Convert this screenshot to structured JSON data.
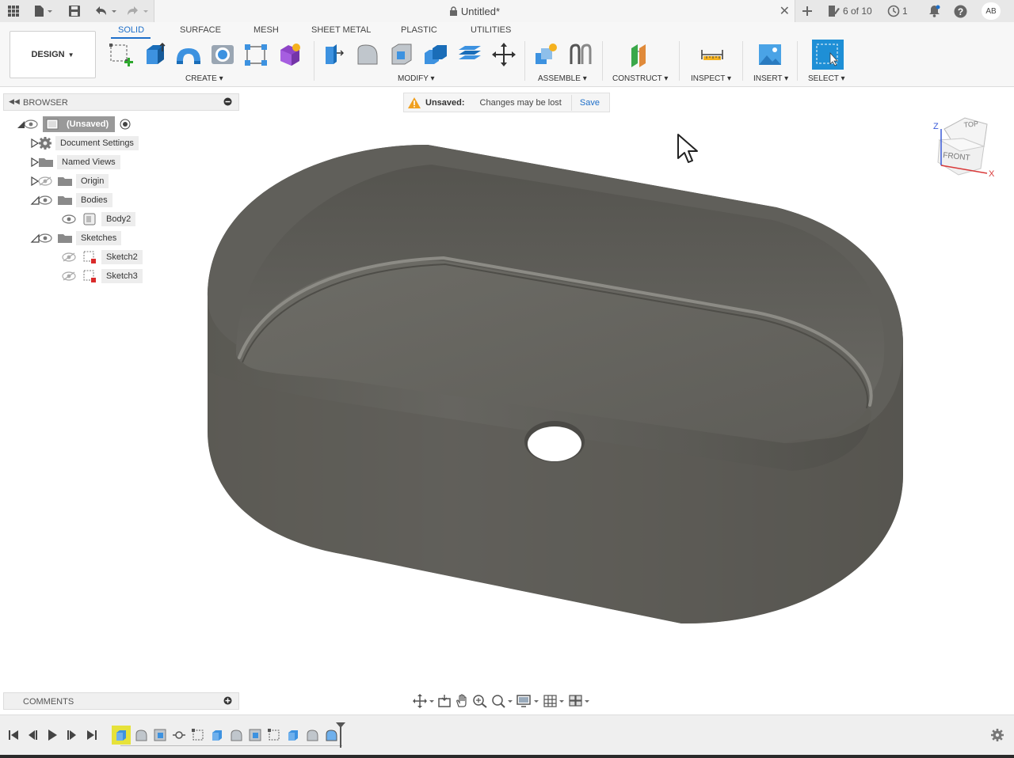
{
  "titlebar": {
    "doc_title": "Untitled*",
    "jobs_count": "6 of 10",
    "history_count": "1",
    "user_initials": "AB"
  },
  "toolbar": {
    "workspace_label": "DESIGN",
    "tabs": [
      "SOLID",
      "SURFACE",
      "MESH",
      "SHEET METAL",
      "PLASTIC",
      "UTILITIES"
    ],
    "groups": {
      "create": "CREATE",
      "modify": "MODIFY",
      "assemble": "ASSEMBLE",
      "construct": "CONSTRUCT",
      "inspect": "INSPECT",
      "insert": "INSERT",
      "select": "SELECT"
    }
  },
  "browser": {
    "title": "BROWSER",
    "root": "(Unsaved)",
    "items": {
      "document_settings": "Document Settings",
      "named_views": "Named Views",
      "origin": "Origin",
      "bodies": "Bodies",
      "body2": "Body2",
      "sketches": "Sketches",
      "sketch2": "Sketch2",
      "sketch3": "Sketch3"
    }
  },
  "unsaved": {
    "label": "Unsaved:",
    "message": "Changes may be lost",
    "save": "Save"
  },
  "viewcube": {
    "top": "TOP",
    "front": "FRONT",
    "axis_z": "Z",
    "axis_x": "X"
  },
  "comments": {
    "title": "COMMENTS"
  },
  "colors": {
    "accent": "#1e6fc9",
    "model": "#5f5e58",
    "warning": "#f0a020"
  }
}
